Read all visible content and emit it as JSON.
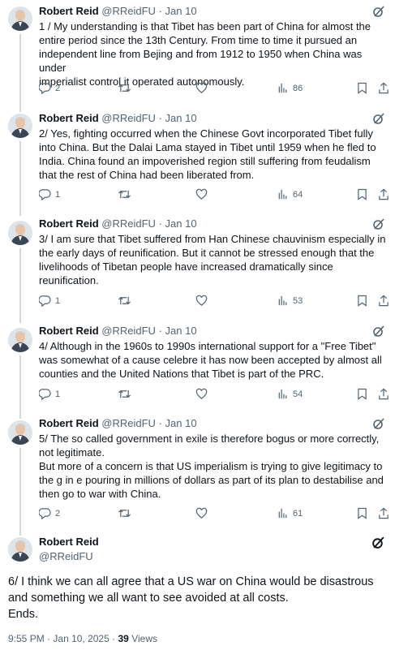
{
  "author": {
    "name": "Robert Reid",
    "handle": "@RReidFU",
    "separator": "·"
  },
  "thread": [
    {
      "date": "Jan 10",
      "text": "1 / My understanding is that Tibet has been part of  China for almost the\nentire period since the 13th Century.  From time to time it pursued an\nindependent line from Bejing and from 1912 to 1950 when China was under\nimperialist control it operated  autonomously.",
      "replies": "2",
      "retweets": "",
      "likes": "",
      "views": "86"
    },
    {
      "date": "Jan 10",
      "text": "2/ Yes, fighting occurred when the Chinese Govt incorporated Tibet fully\ninto China.  But  the Dalai Lama stayed in Tibet until 1959 when he fled to\nIndia.  China found an impoverished region still suffering from feudalism\nthat the rest of China had been liberated from.",
      "replies": "1",
      "retweets": "",
      "likes": "",
      "views": "64"
    },
    {
      "date": "Jan 10",
      "text": "3/ I am sure that Tibet suffered from Han Chinese chauvinism especially in\nthe early days of reunification. But it cannot be stressed enough that the\nlivelihoods of Tibetan people have increased dramatically since\nreunification.",
      "replies": "1",
      "retweets": "",
      "likes": "",
      "views": "53"
    },
    {
      "date": "Jan 10",
      "text": "4/ Although in the 1960s to 1990s international support for a \"Free Tibet\"\nwas somewhat of a cause celebre it has now been accepted by almost all\ncounties and the United Nations that Tibet is part of the PRC.",
      "replies": "1",
      "retweets": "",
      "likes": "",
      "views": "54"
    },
    {
      "date": "Jan 10",
      "text": "5/ The so called government in exile is therefore bogus or more correctly,\nnot legitimate.\nBut more of a concern is that US imperialism is trying to give legitimacy to\nthe g in e pouring in millions of dollars as part of its plan to destabilise and\nthen go to war with China.",
      "replies": "2",
      "retweets": "",
      "likes": "",
      "views": "61"
    }
  ],
  "main_tweet": {
    "text": "6/ I think we can all agree that a US war on China would be disastrous\nand something we all want to see avoided at all costs.\nEnds.",
    "time": "9:55 PM",
    "date": "Jan 10, 2025",
    "views_count": "39",
    "views_label": "Views"
  },
  "icons": {
    "avatar": "avatar-photo",
    "more": "grok-slash-circle-icon",
    "reply": "reply-icon",
    "retweet": "retweet-icon",
    "like": "heart-icon",
    "views": "views-bars-icon",
    "bookmark": "bookmark-icon",
    "share": "share-icon"
  },
  "colors": {
    "text": "#0f1419",
    "secondary": "#536471",
    "thread_line": "#cfd9de"
  }
}
